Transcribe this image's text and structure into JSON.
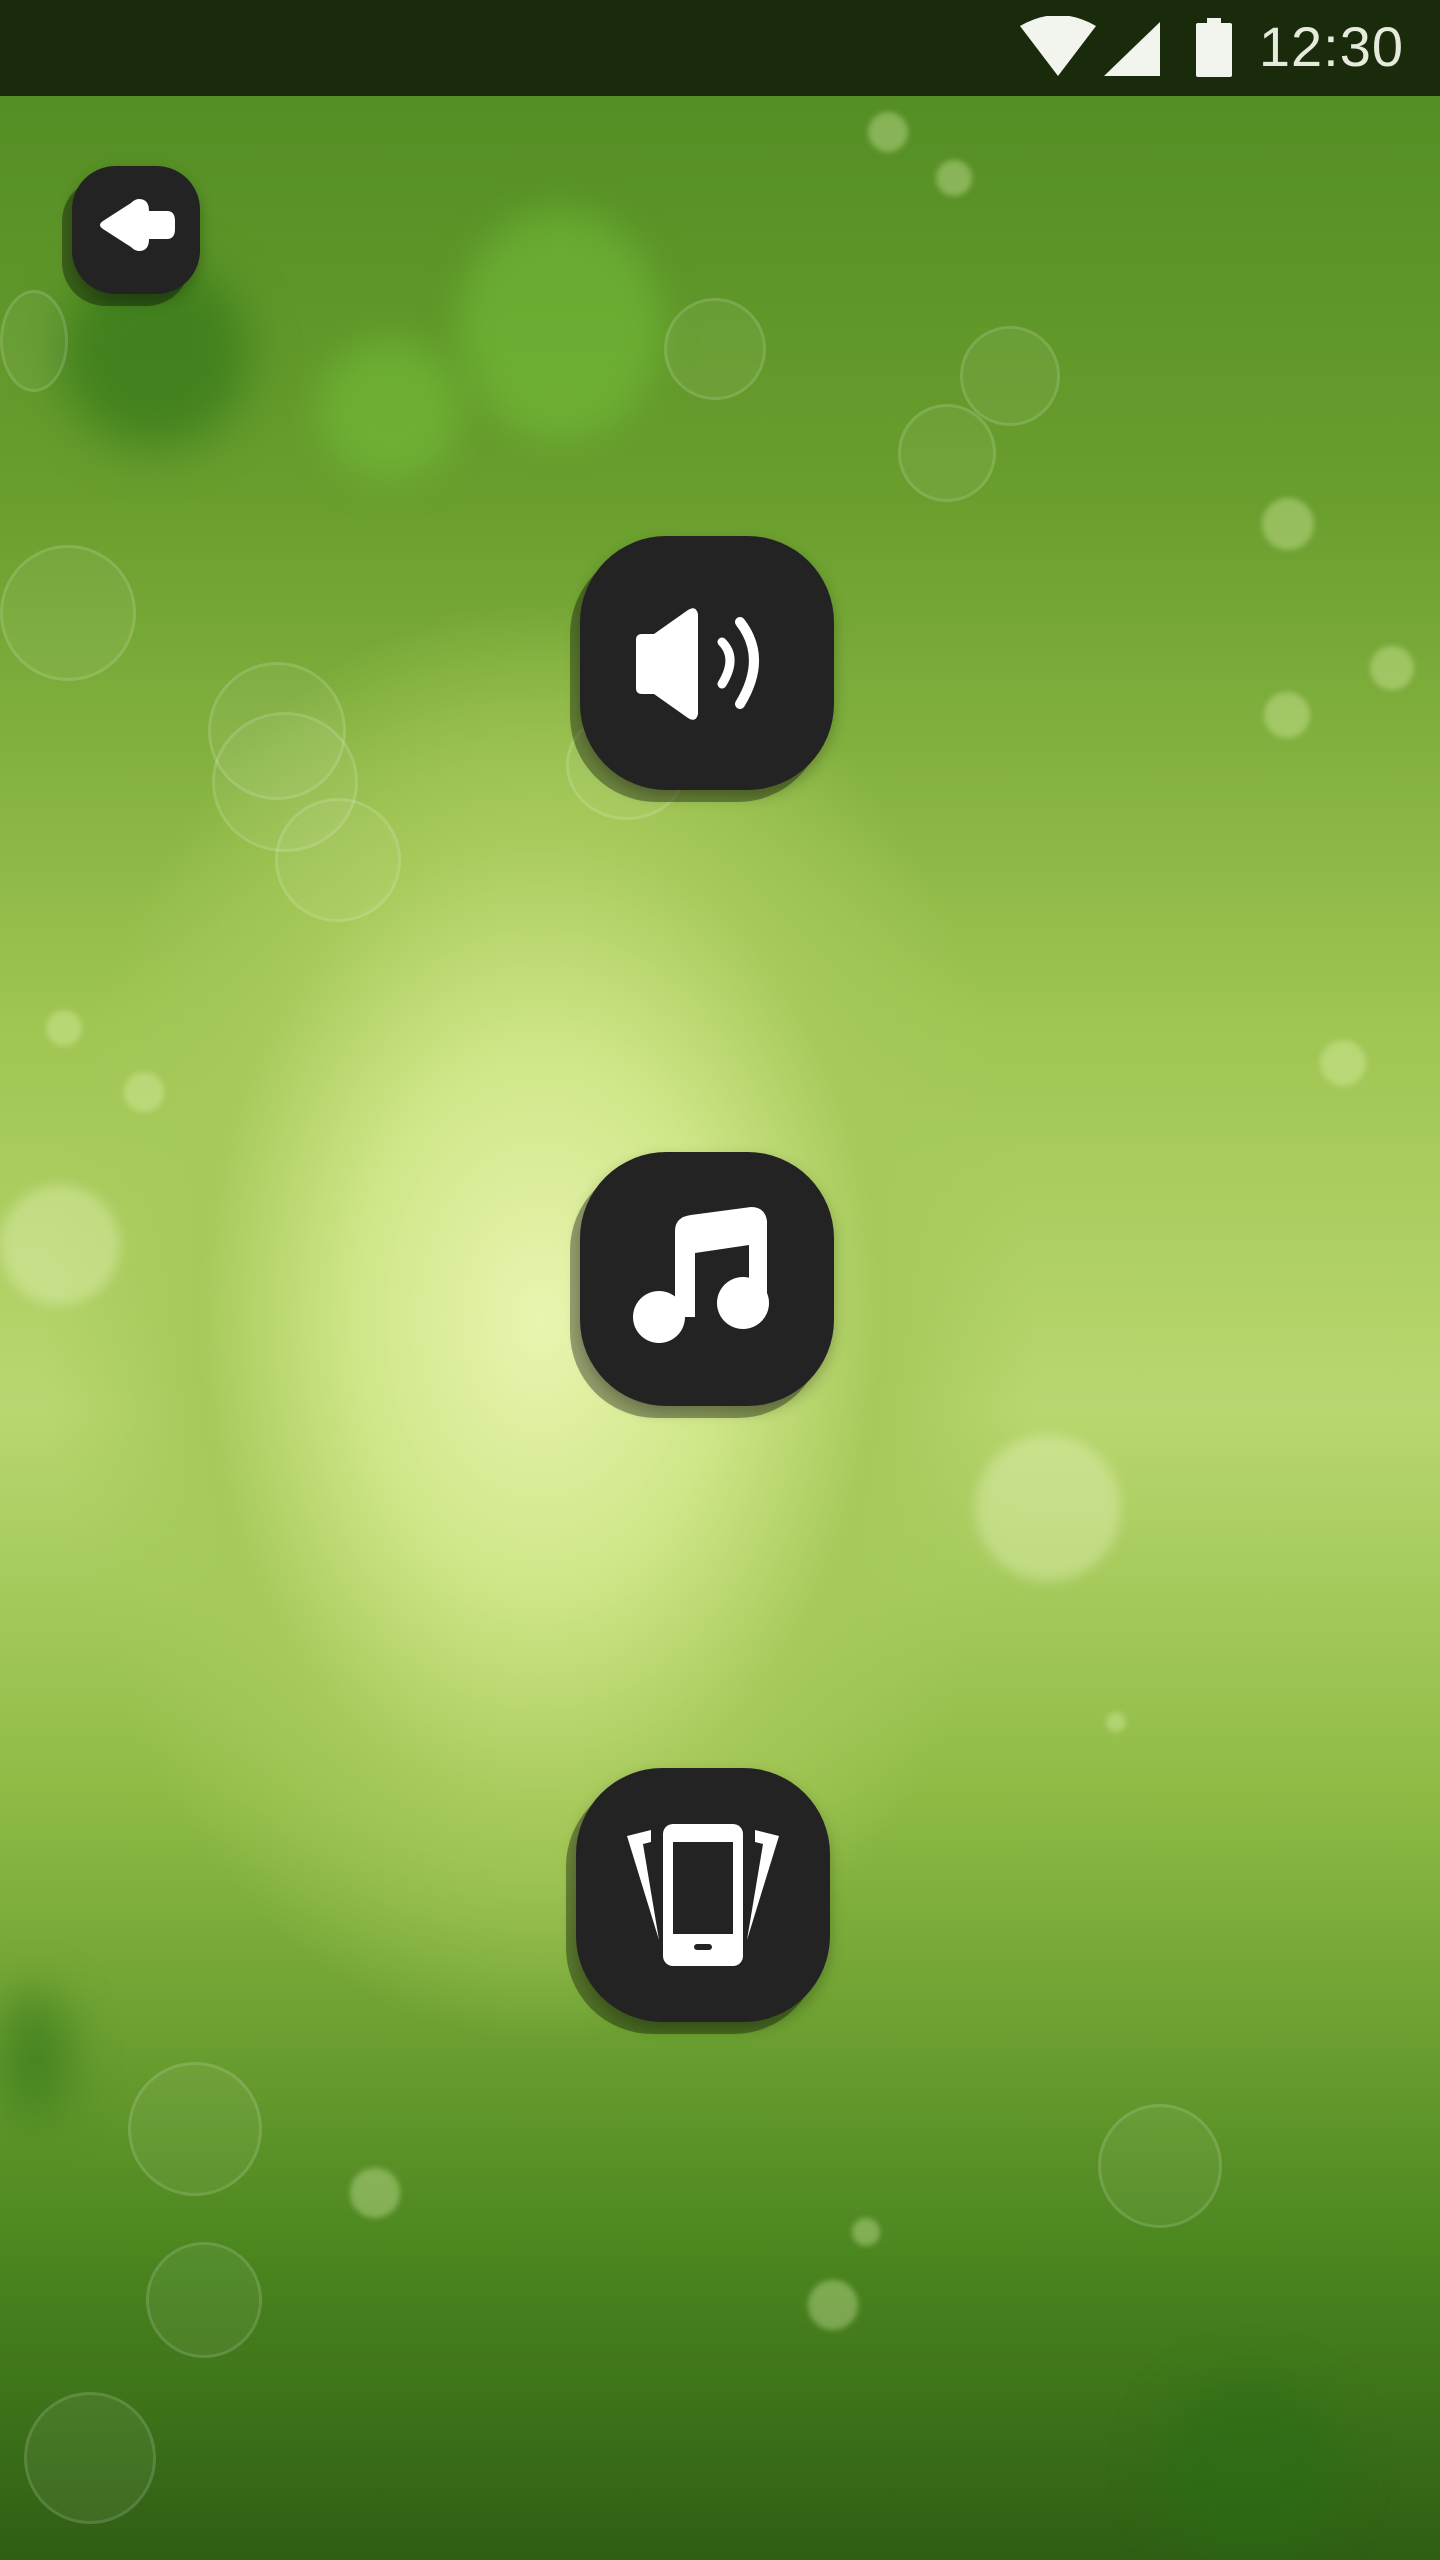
{
  "status_bar": {
    "time": "12:30",
    "icons": [
      "wifi-icon",
      "cellular-signal-icon",
      "battery-icon"
    ]
  },
  "toolbar": {
    "back_icon": "back-arrow-icon"
  },
  "menu": {
    "buttons": [
      {
        "icon": "speaker-sound-icon"
      },
      {
        "icon": "music-note-icon"
      },
      {
        "icon": "vibrate-phone-icon"
      }
    ]
  },
  "colors": {
    "button_fill": "#232323",
    "icon_color": "#ffffff",
    "status_bar": "#1a2b0c",
    "background_center": "#e8f5b0",
    "background_edge": "#2f5e14"
  }
}
